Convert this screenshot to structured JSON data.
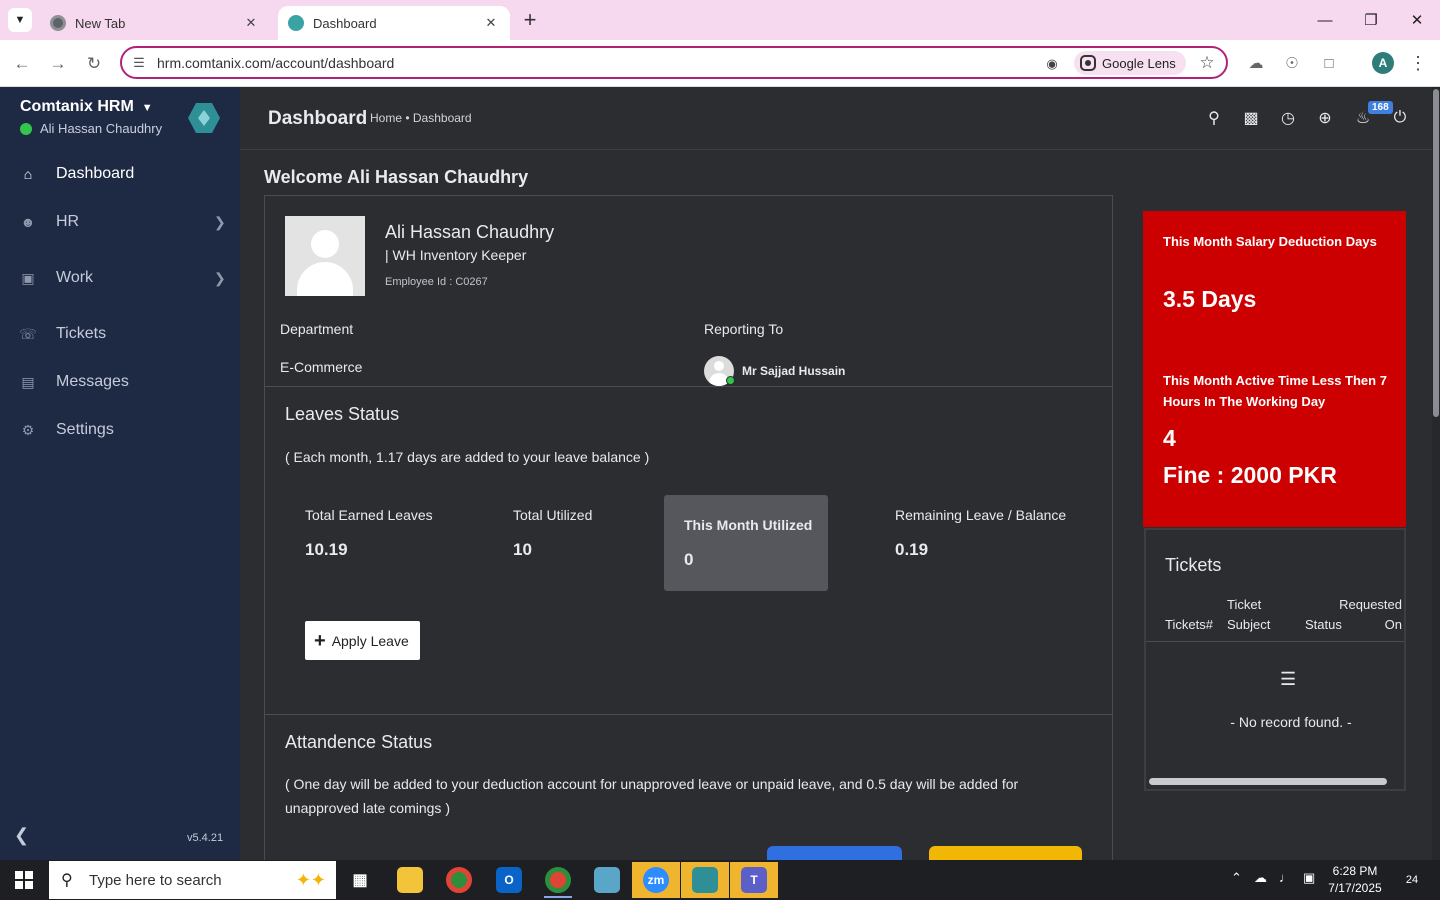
{
  "browser": {
    "tabs": [
      {
        "title": "New Tab",
        "active": false
      },
      {
        "title": "Dashboard",
        "active": true
      }
    ],
    "url": "hrm.comtanix.com/account/dashboard",
    "lens_label": "Google Lens",
    "profile_initial": "A"
  },
  "sidebar": {
    "brand": "Comtanix HRM",
    "user": "Ali Hassan Chaudhry",
    "items": [
      {
        "label": "Dashboard",
        "icon": "home-icon",
        "active": true
      },
      {
        "label": "HR",
        "icon": "users-icon",
        "has_children": true
      },
      {
        "label": "Work",
        "icon": "briefcase-icon",
        "has_children": true
      },
      {
        "label": "Tickets",
        "icon": "headset-icon"
      },
      {
        "label": "Messages",
        "icon": "message-icon"
      },
      {
        "label": "Settings",
        "icon": "gear-icon"
      }
    ],
    "version": "v5.4.21"
  },
  "header": {
    "title": "Dashboard",
    "breadcrumb": "Home • Dashboard",
    "notification_count": "168"
  },
  "welcome": "Welcome Ali Hassan Chaudhry",
  "profile": {
    "name": "Ali Hassan Chaudhry",
    "role": "| WH Inventory Keeper",
    "employee_id": "Employee Id : C0267",
    "department_label": "Department",
    "department": "E-Commerce",
    "reporting_label": "Reporting To",
    "reporting_to": "Mr Sajjad Hussain"
  },
  "leaves": {
    "title": "Leaves Status",
    "note": "( Each month, 1.17 days are added to your leave balance )",
    "stats": [
      {
        "label": "Total Earned Leaves",
        "value": "10.19"
      },
      {
        "label": "Total Utilized",
        "value": "10"
      },
      {
        "label": "This Month Utilized",
        "value": "0"
      },
      {
        "label": "Remaining Leave / Balance",
        "value": "0.19"
      }
    ],
    "apply_label": "Apply Leave"
  },
  "attendance": {
    "title": "Attandence Status",
    "note": "( One day will be added to your deduction account for unapproved leave or unpaid leave, and 0.5 day will be added for unapproved late comings )"
  },
  "deductions": {
    "salary_label": "This Month Salary Deduction Days",
    "salary_value": "3.5 Days",
    "active_label": "This Month Active Time Less Then 7 Hours In The Working Day",
    "active_value": "4",
    "fine": "Fine : 2000 PKR"
  },
  "tickets": {
    "title": "Tickets",
    "columns": [
      "Tickets#",
      "Ticket Subject",
      "Status",
      "Requested On"
    ],
    "empty": "- No record found. -"
  },
  "taskbar": {
    "search_placeholder": "Type here to search",
    "time": "6:28 PM",
    "date": "7/17/2025",
    "notifications": "24"
  },
  "colors": {
    "sidebar": "#1e2944",
    "content": "#2b2d31",
    "alert": "#cc0000",
    "accent_blue": "#2f6fe0",
    "accent_yellow": "#f2b705"
  }
}
